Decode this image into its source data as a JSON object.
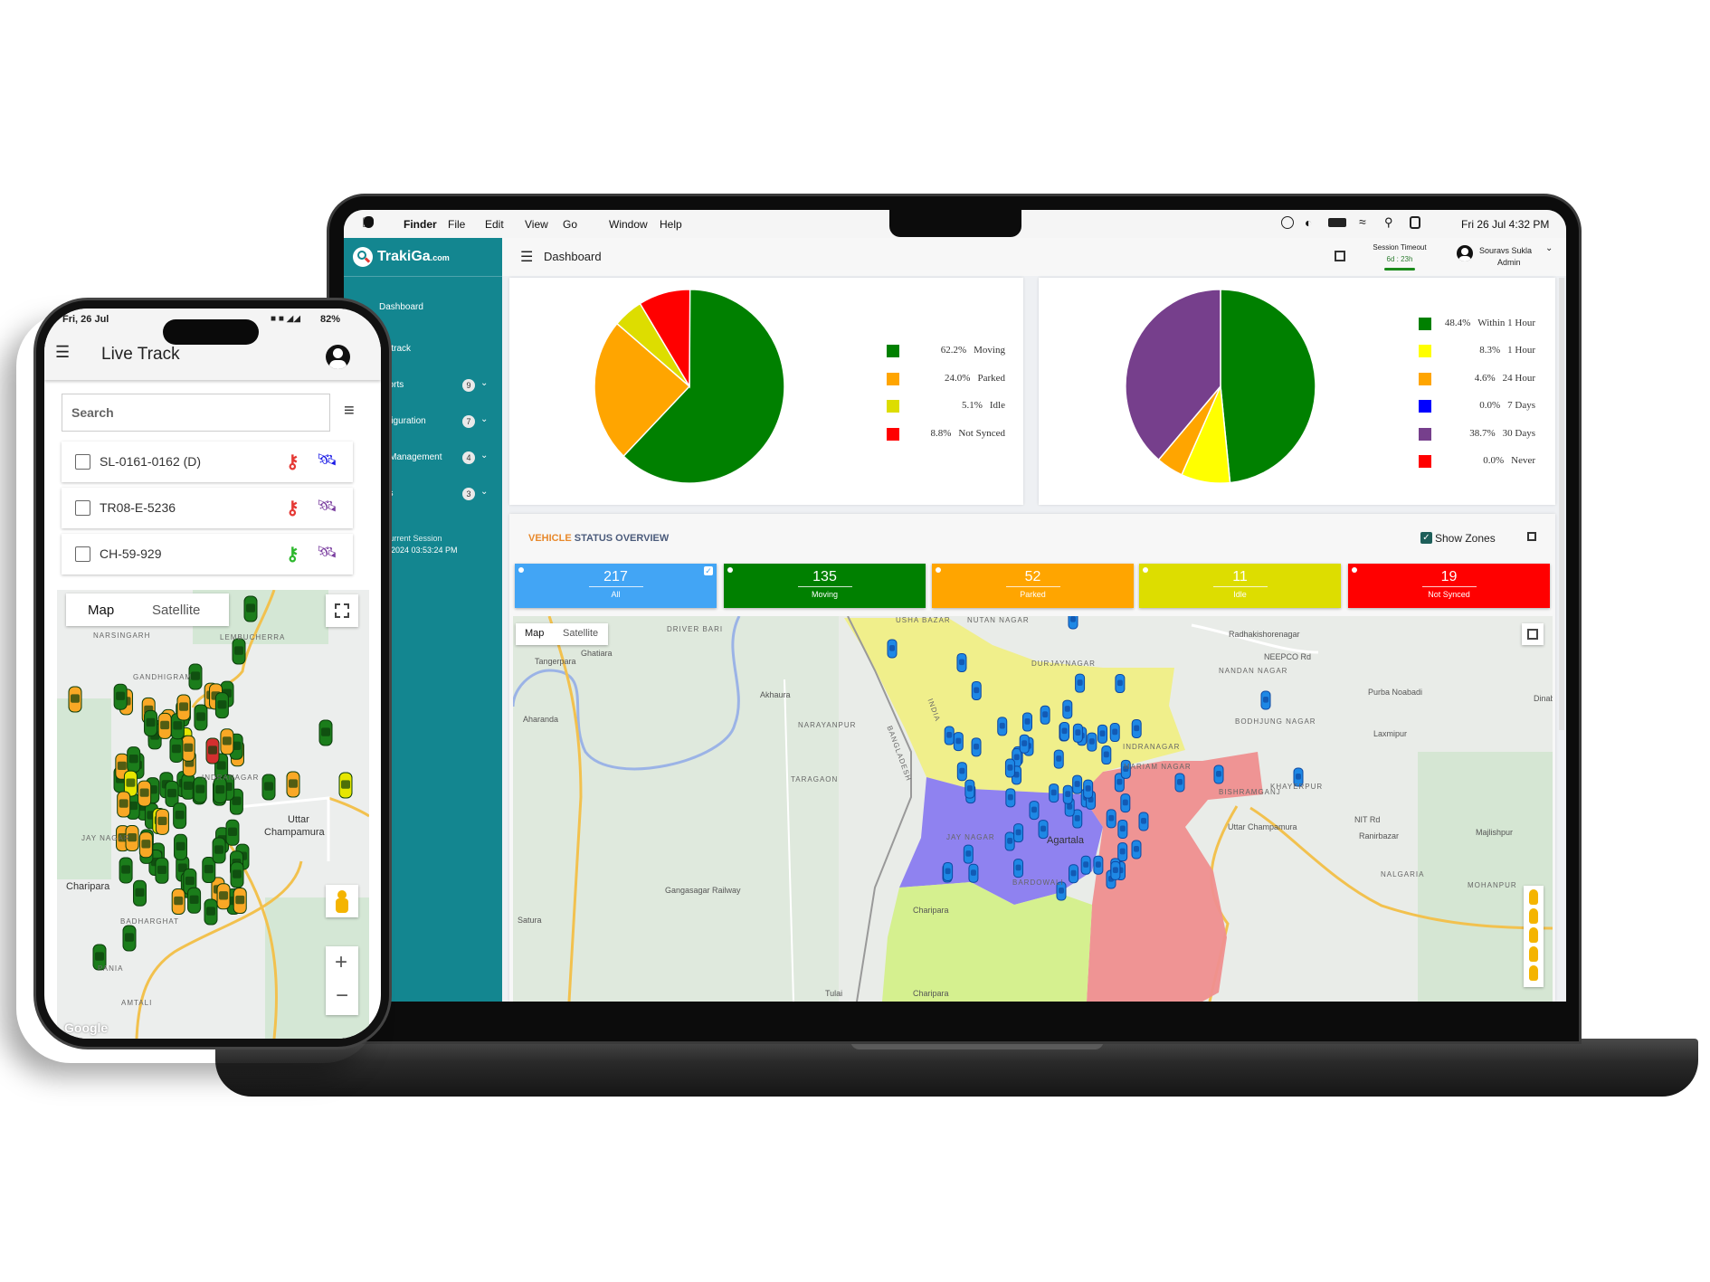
{
  "mac_menubar": {
    "apple_icon": "apple-logo-icon",
    "app": "Finder",
    "menus": [
      "File",
      "Edit",
      "View",
      "Go",
      "Window",
      "Help"
    ],
    "status_icons": [
      "play-circle-icon",
      "siri-icon",
      "battery-icon",
      "wifi-icon",
      "search-icon",
      "control-center-icon"
    ],
    "clock": "Fri 26 Jul  4:32 PM"
  },
  "app": {
    "logo": "TrakiGa",
    "logo_suffix": ".com",
    "page_title": "Dashboard",
    "session": {
      "label": "Session Timeout",
      "value": "6d : 23h"
    },
    "user": {
      "name": "Souravs Sukla",
      "role": "Admin"
    }
  },
  "sidebar": {
    "items": [
      {
        "label": "Dashboard"
      },
      {
        "label": "e track"
      },
      {
        "label": "ports",
        "badge": "9"
      },
      {
        "label": "nfiguration",
        "badge": "7"
      },
      {
        "label": ") Management",
        "badge": "4"
      },
      {
        "label": "gs",
        "badge": "3"
      }
    ],
    "session_label": "Current Session",
    "session_value": "7-2024 03:53:24 PM"
  },
  "chart_data": [
    {
      "type": "pie",
      "legend": "right",
      "slices": [
        {
          "label": "Moving",
          "pct": "62.2%",
          "value": 62.2,
          "color": "#008000"
        },
        {
          "label": "Parked",
          "pct": "24.0%",
          "value": 24.0,
          "color": "#ffa500"
        },
        {
          "label": "Idle",
          "pct": "5.1%",
          "value": 5.1,
          "color": "#dddd00"
        },
        {
          "label": "Not Synced",
          "pct": "8.8%",
          "value": 8.8,
          "color": "#ff0000"
        }
      ]
    },
    {
      "type": "pie",
      "legend": "right",
      "slices": [
        {
          "label": "Within 1 Hour",
          "pct": "48.4%",
          "value": 48.4,
          "color": "#008000"
        },
        {
          "label": "1 Hour",
          "pct": "8.3%",
          "value": 8.3,
          "color": "#ffff00"
        },
        {
          "label": "24 Hour",
          "pct": "4.6%",
          "value": 4.6,
          "color": "#ffa500"
        },
        {
          "label": "7 Days",
          "pct": "0.0%",
          "value": 0.0,
          "color": "#0000ff"
        },
        {
          "label": "30 Days",
          "pct": "38.7%",
          "value": 38.7,
          "color": "#763f8c"
        },
        {
          "label": "Never",
          "pct": "0.0%",
          "value": 0.0,
          "color": "#ff0000"
        }
      ]
    }
  ],
  "vehicle_status": {
    "title_part1": "VEHICLE",
    "title_part2": " STATUS OVERVIEW",
    "show_zones_label": "Show Zones",
    "show_zones_checked": true,
    "boxes": [
      {
        "count": "217",
        "label": "All",
        "color": "#42a5f5",
        "selected": true
      },
      {
        "count": "135",
        "label": "Moving",
        "color": "#008000"
      },
      {
        "count": "52",
        "label": "Parked",
        "color": "#ffa500"
      },
      {
        "count": "11",
        "label": "Idle",
        "color": "#dddd00"
      },
      {
        "count": "19",
        "label": "Not Synced",
        "color": "#ff0000"
      }
    ]
  },
  "laptop_map": {
    "map_tab": "Map",
    "satellite_tab": "Satellite",
    "zone_colors": {
      "north": "#f0ef86",
      "west": "#8a7cf0",
      "east": "#ef8f8f",
      "south": "#d4f08a"
    },
    "marker_color": "#1e88e5",
    "labels": [
      "DRIVER BARI",
      "Tangerpara",
      "Ghatiara",
      "Aharanda",
      "Akhaura",
      "NARAYANPUR",
      "TARAGAON",
      "Gangasagar Railway",
      "Satura",
      "Tulai",
      "Charipara",
      "Charipara",
      "JAY NAGAR",
      "Agartala",
      "BARDOWALI",
      "BANGLADESH",
      "INDIA",
      "USHA BAZAR",
      "NUTAN NAGAR",
      "DURJAYNAGAR",
      "Radhakishorenagar",
      "NANDAN NAGAR",
      "BODHJUNG NAGAR",
      "INDRANAGAR",
      "MARIAM NAGAR",
      "BISHRAMGANJ",
      "KHAYERPUR",
      "Uttar Champamura",
      "Purba Noabadi",
      "Laxmipur",
      "Dinabandh",
      "Ranirbazar",
      "Majlishpur",
      "NALGARIA",
      "MOHANPUR",
      "NEEPCO Rd",
      "NIT Rd"
    ]
  },
  "phone": {
    "status_date": "Fri, 26 Jul",
    "battery": "82%",
    "title": "Live Track",
    "search_placeholder": "Search",
    "vehicles": [
      {
        "id": "SL-0161-0162 (D)",
        "ignition_color": "#e53935",
        "gps_color": "#1a1ae6"
      },
      {
        "id": "TR08-E-5236",
        "ignition_color": "#e53935",
        "gps_color": "#7b3fa0"
      },
      {
        "id": "CH-59-929",
        "ignition_color": "#2eb82e",
        "gps_color": "#7b3fa0"
      }
    ],
    "map": {
      "map_tab": "Map",
      "satellite_tab": "Satellite",
      "zoom_in": "+",
      "zoom_out": "−",
      "google": "Google",
      "labels": [
        "NARSINGARH",
        "LEMBUCHERRA",
        "GANDHIGRAM",
        "INDRANAGAR",
        "Uttar",
        "Champamura",
        "JAY NAGAR",
        "Charipara",
        "BADHARGHAT",
        "PANIA",
        "AMTALI"
      ]
    }
  }
}
